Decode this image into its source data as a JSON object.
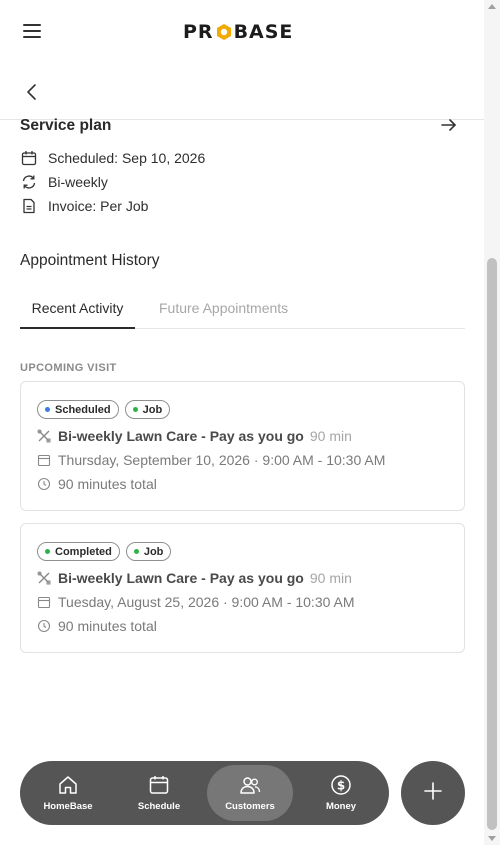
{
  "header": {
    "logo_text_left": "PR",
    "logo_text_right": "BASE",
    "logo_accent": "#f2a900"
  },
  "service_plan": {
    "title": "Service plan",
    "scheduled": "Scheduled: Sep 10, 2026",
    "frequency": "Bi-weekly",
    "invoice": "Invoice: Per Job"
  },
  "history": {
    "title": "Appointment History",
    "tabs": [
      {
        "label": "Recent Activity",
        "active": true
      },
      {
        "label": "Future Appointments",
        "active": false
      }
    ],
    "section_label": "UPCOMING VISIT",
    "cards": [
      {
        "status": "Scheduled",
        "status_color": "#3b7bea",
        "type": "Job",
        "type_color": "#2bb34a",
        "title": "Bi-weekly Lawn Care - Pay as you go",
        "duration": "90 min",
        "datetime": "Thursday, September 10, 2026 · 9:00 AM - 10:30 AM",
        "total": "90 minutes total"
      },
      {
        "status": "Completed",
        "status_color": "#2bb34a",
        "type": "Job",
        "type_color": "#2bb34a",
        "title": "Bi-weekly Lawn Care - Pay as you go",
        "duration": "90 min",
        "datetime": "Tuesday, August 25, 2026 · 9:00 AM - 10:30 AM",
        "total": "90 minutes total"
      }
    ]
  },
  "bottom_nav": {
    "items": [
      {
        "label": "HomeBase",
        "icon": "home-icon",
        "active": false
      },
      {
        "label": "Schedule",
        "icon": "calendar-icon",
        "active": false
      },
      {
        "label": "Customers",
        "icon": "users-icon",
        "active": true
      },
      {
        "label": "Money",
        "icon": "dollar-icon",
        "active": false
      }
    ],
    "fab_icon": "plus-icon"
  }
}
